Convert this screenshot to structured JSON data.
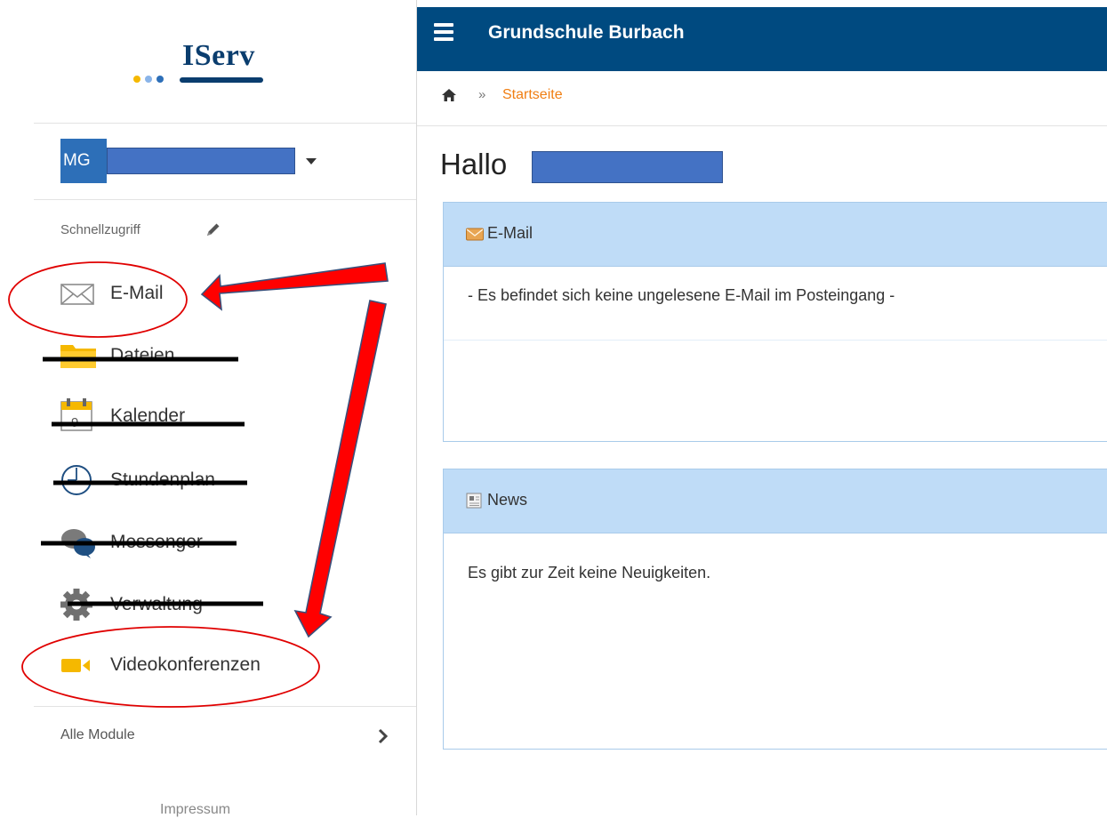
{
  "logo": {
    "text": "IServ",
    "dot_colors": [
      "#f5b800",
      "#8ab4e8",
      "#2d6fb8"
    ]
  },
  "user": {
    "initials": "MG"
  },
  "quick_access": {
    "title": "Schnellzugriff"
  },
  "nav": {
    "items": [
      {
        "label": "E-Mail",
        "icon": "envelope-icon"
      },
      {
        "label": "Dateien",
        "icon": "folder-icon"
      },
      {
        "label": "Kalender",
        "icon": "calendar-icon"
      },
      {
        "label": "Stundenplan",
        "icon": "clock-icon"
      },
      {
        "label": "Messenger",
        "icon": "chat-bubbles-icon"
      },
      {
        "label": "Verwaltung",
        "icon": "gear-icon"
      },
      {
        "label": "Videokonferenzen",
        "icon": "video-camera-icon"
      }
    ]
  },
  "modules": {
    "label": "Alle Module"
  },
  "footer": {
    "impressum": "Impressum"
  },
  "topbar": {
    "title": "Grundschule Burbach",
    "color": "#004a80"
  },
  "breadcrumb": {
    "current": "Startseite",
    "separator": "»"
  },
  "greeting": {
    "text": "Hallo"
  },
  "panels": {
    "email": {
      "title": "E-Mail",
      "body": "- Es befindet sich keine ungelesene E-Mail im Posteingang -"
    },
    "news": {
      "title": "News",
      "body": "Es gibt zur Zeit keine Neuigkeiten."
    }
  },
  "colors": {
    "accent_orange": "#f07e12",
    "panel_header": "#bfdcf7",
    "annotation_red": "#ff0000"
  }
}
